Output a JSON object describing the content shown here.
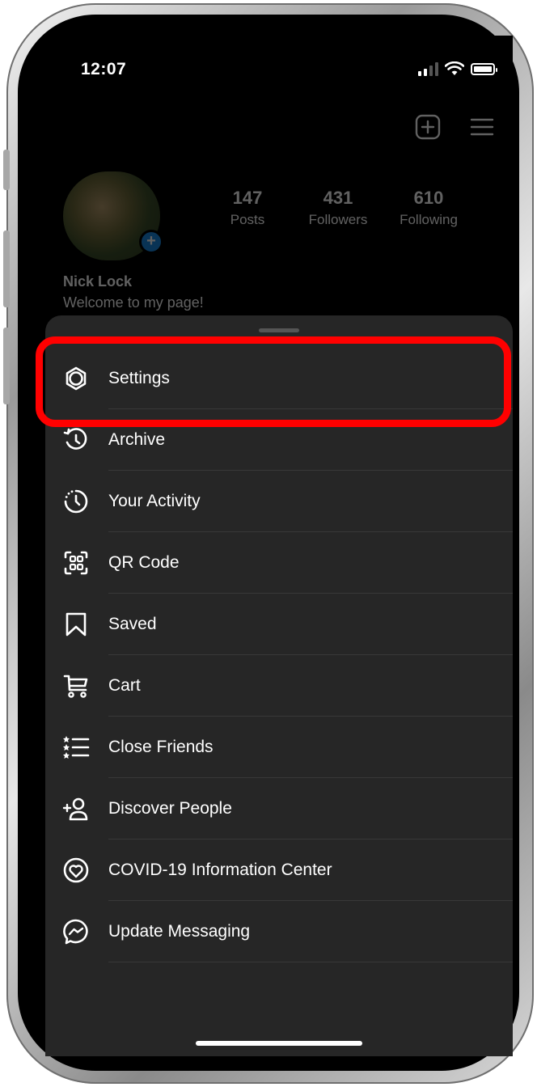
{
  "status": {
    "time": "12:07"
  },
  "profile": {
    "stats": [
      {
        "value": "147",
        "label": "Posts"
      },
      {
        "value": "431",
        "label": "Followers"
      },
      {
        "value": "610",
        "label": "Following"
      }
    ],
    "name": "Nick Lock",
    "bio": "Welcome to my page!",
    "avatar_add_symbol": "+"
  },
  "menu": {
    "items": [
      {
        "label": "Settings",
        "icon": "gear-icon"
      },
      {
        "label": "Archive",
        "icon": "archive-icon"
      },
      {
        "label": "Your Activity",
        "icon": "activity-icon"
      },
      {
        "label": "QR Code",
        "icon": "qr-code-icon"
      },
      {
        "label": "Saved",
        "icon": "bookmark-icon"
      },
      {
        "label": "Cart",
        "icon": "cart-icon"
      },
      {
        "label": "Close Friends",
        "icon": "close-friends-icon"
      },
      {
        "label": "Discover People",
        "icon": "add-person-icon"
      },
      {
        "label": "COVID-19 Information Center",
        "icon": "covid-info-icon"
      },
      {
        "label": "Update Messaging",
        "icon": "messenger-icon"
      }
    ]
  },
  "colors": {
    "sheet_bg": "#262626",
    "highlight": "#ff0000",
    "accent_blue": "#1a87e0"
  }
}
